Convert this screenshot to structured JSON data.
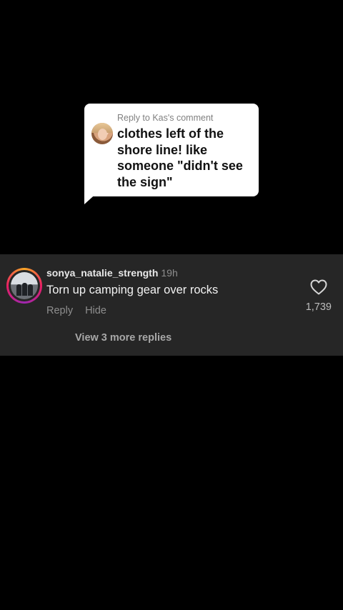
{
  "reply_bubble": {
    "header": "Reply to Kas's comment",
    "text": "clothes left of the shore line! like someone \"didn't see the sign\""
  },
  "comment": {
    "username": "sonya_natalie_strength",
    "timestamp": "19h",
    "text": "Torn up camping gear over rocks",
    "reply_label": "Reply",
    "hide_label": "Hide",
    "like_count": "1,739",
    "view_replies_label": "View 3 more replies"
  },
  "icons": {
    "like": "heart-outline-icon"
  },
  "colors": {
    "background": "#000000",
    "panel": "#262626",
    "bubble": "#ffffff"
  }
}
